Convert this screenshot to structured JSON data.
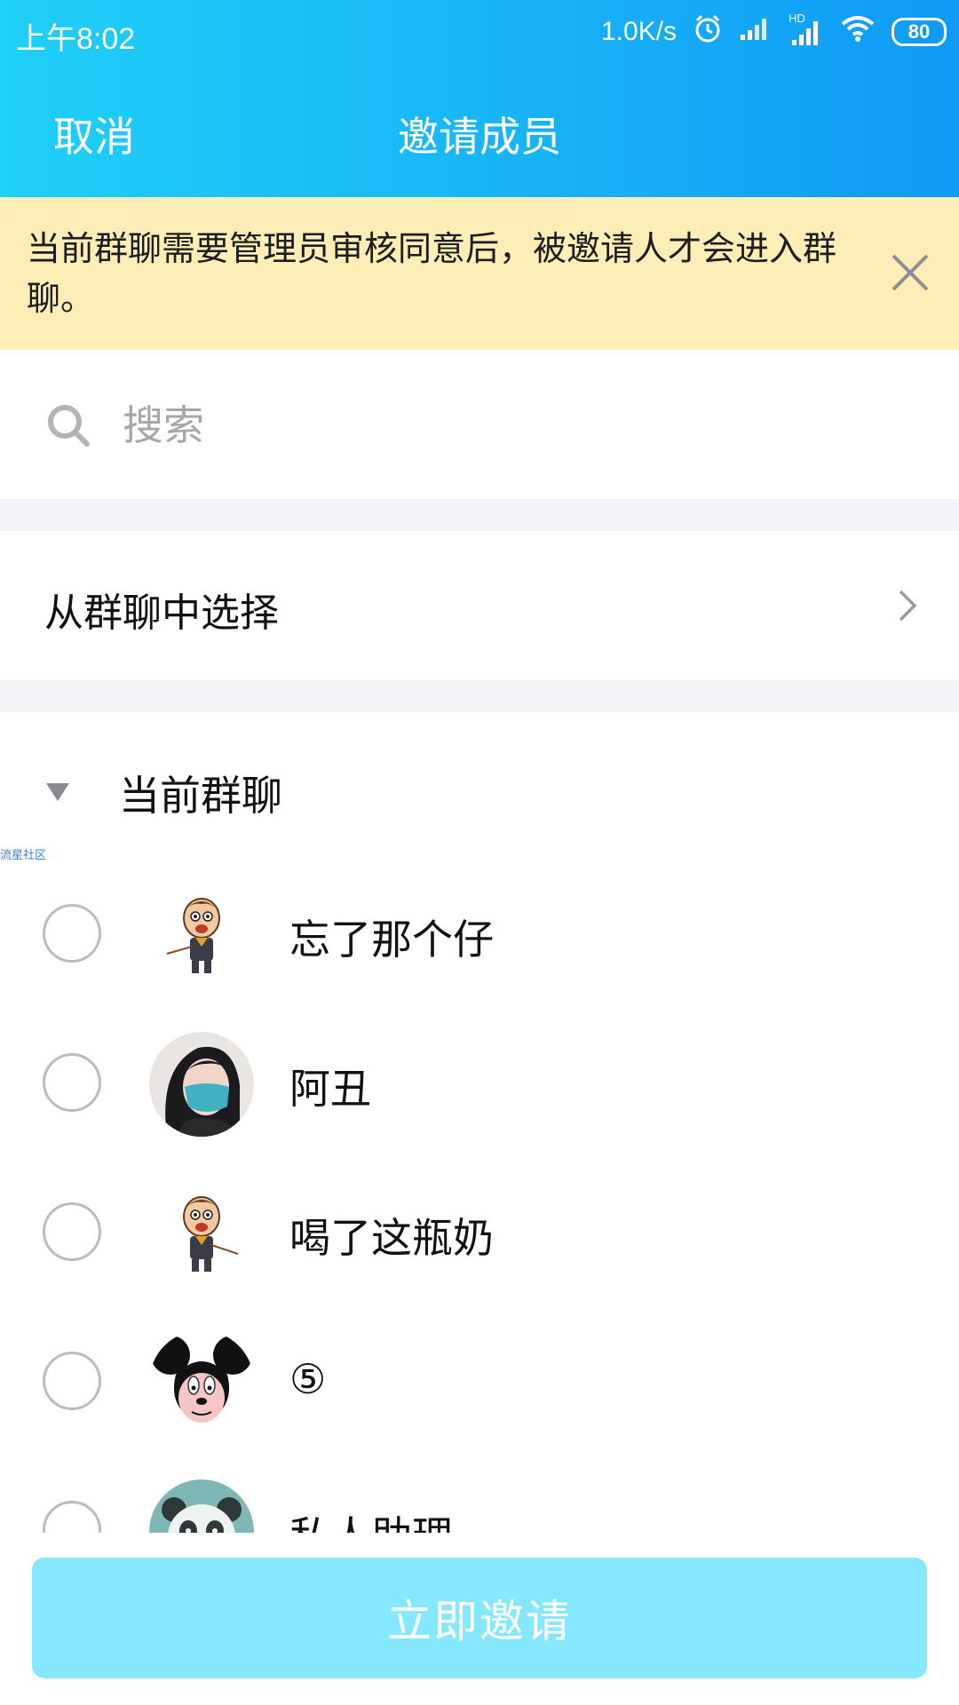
{
  "status_bar": {
    "time": "上午8:02",
    "network_speed": "1.0K/s",
    "network_badge": "HD",
    "battery": "80"
  },
  "nav": {
    "cancel": "取消",
    "title": "邀请成员"
  },
  "notice": {
    "text": "当前群聊需要管理员审核同意后，被邀请人才会进入群聊。"
  },
  "search": {
    "placeholder": "搜索"
  },
  "select_from_group": {
    "label": "从群聊中选择"
  },
  "current_group": {
    "title": "当前群聊",
    "members": [
      {
        "name": "忘了那个仔",
        "avatar": "cartoon-boy"
      },
      {
        "name": "阿丑",
        "avatar": "photo-masked-woman"
      },
      {
        "name": "喝了这瓶奶",
        "avatar": "cartoon-boy"
      },
      {
        "name": "⑤",
        "avatar": "cartoon-mouse"
      },
      {
        "name": "私人助理",
        "avatar": "cartoon-panda"
      }
    ]
  },
  "watermark": "流星社区",
  "invite_button": "立即邀请",
  "colors": {
    "header_start": "#1fd0f7",
    "header_end": "#0f9af5",
    "notice_bg": "#fdedb6",
    "button_bg": "#86e8fc"
  }
}
